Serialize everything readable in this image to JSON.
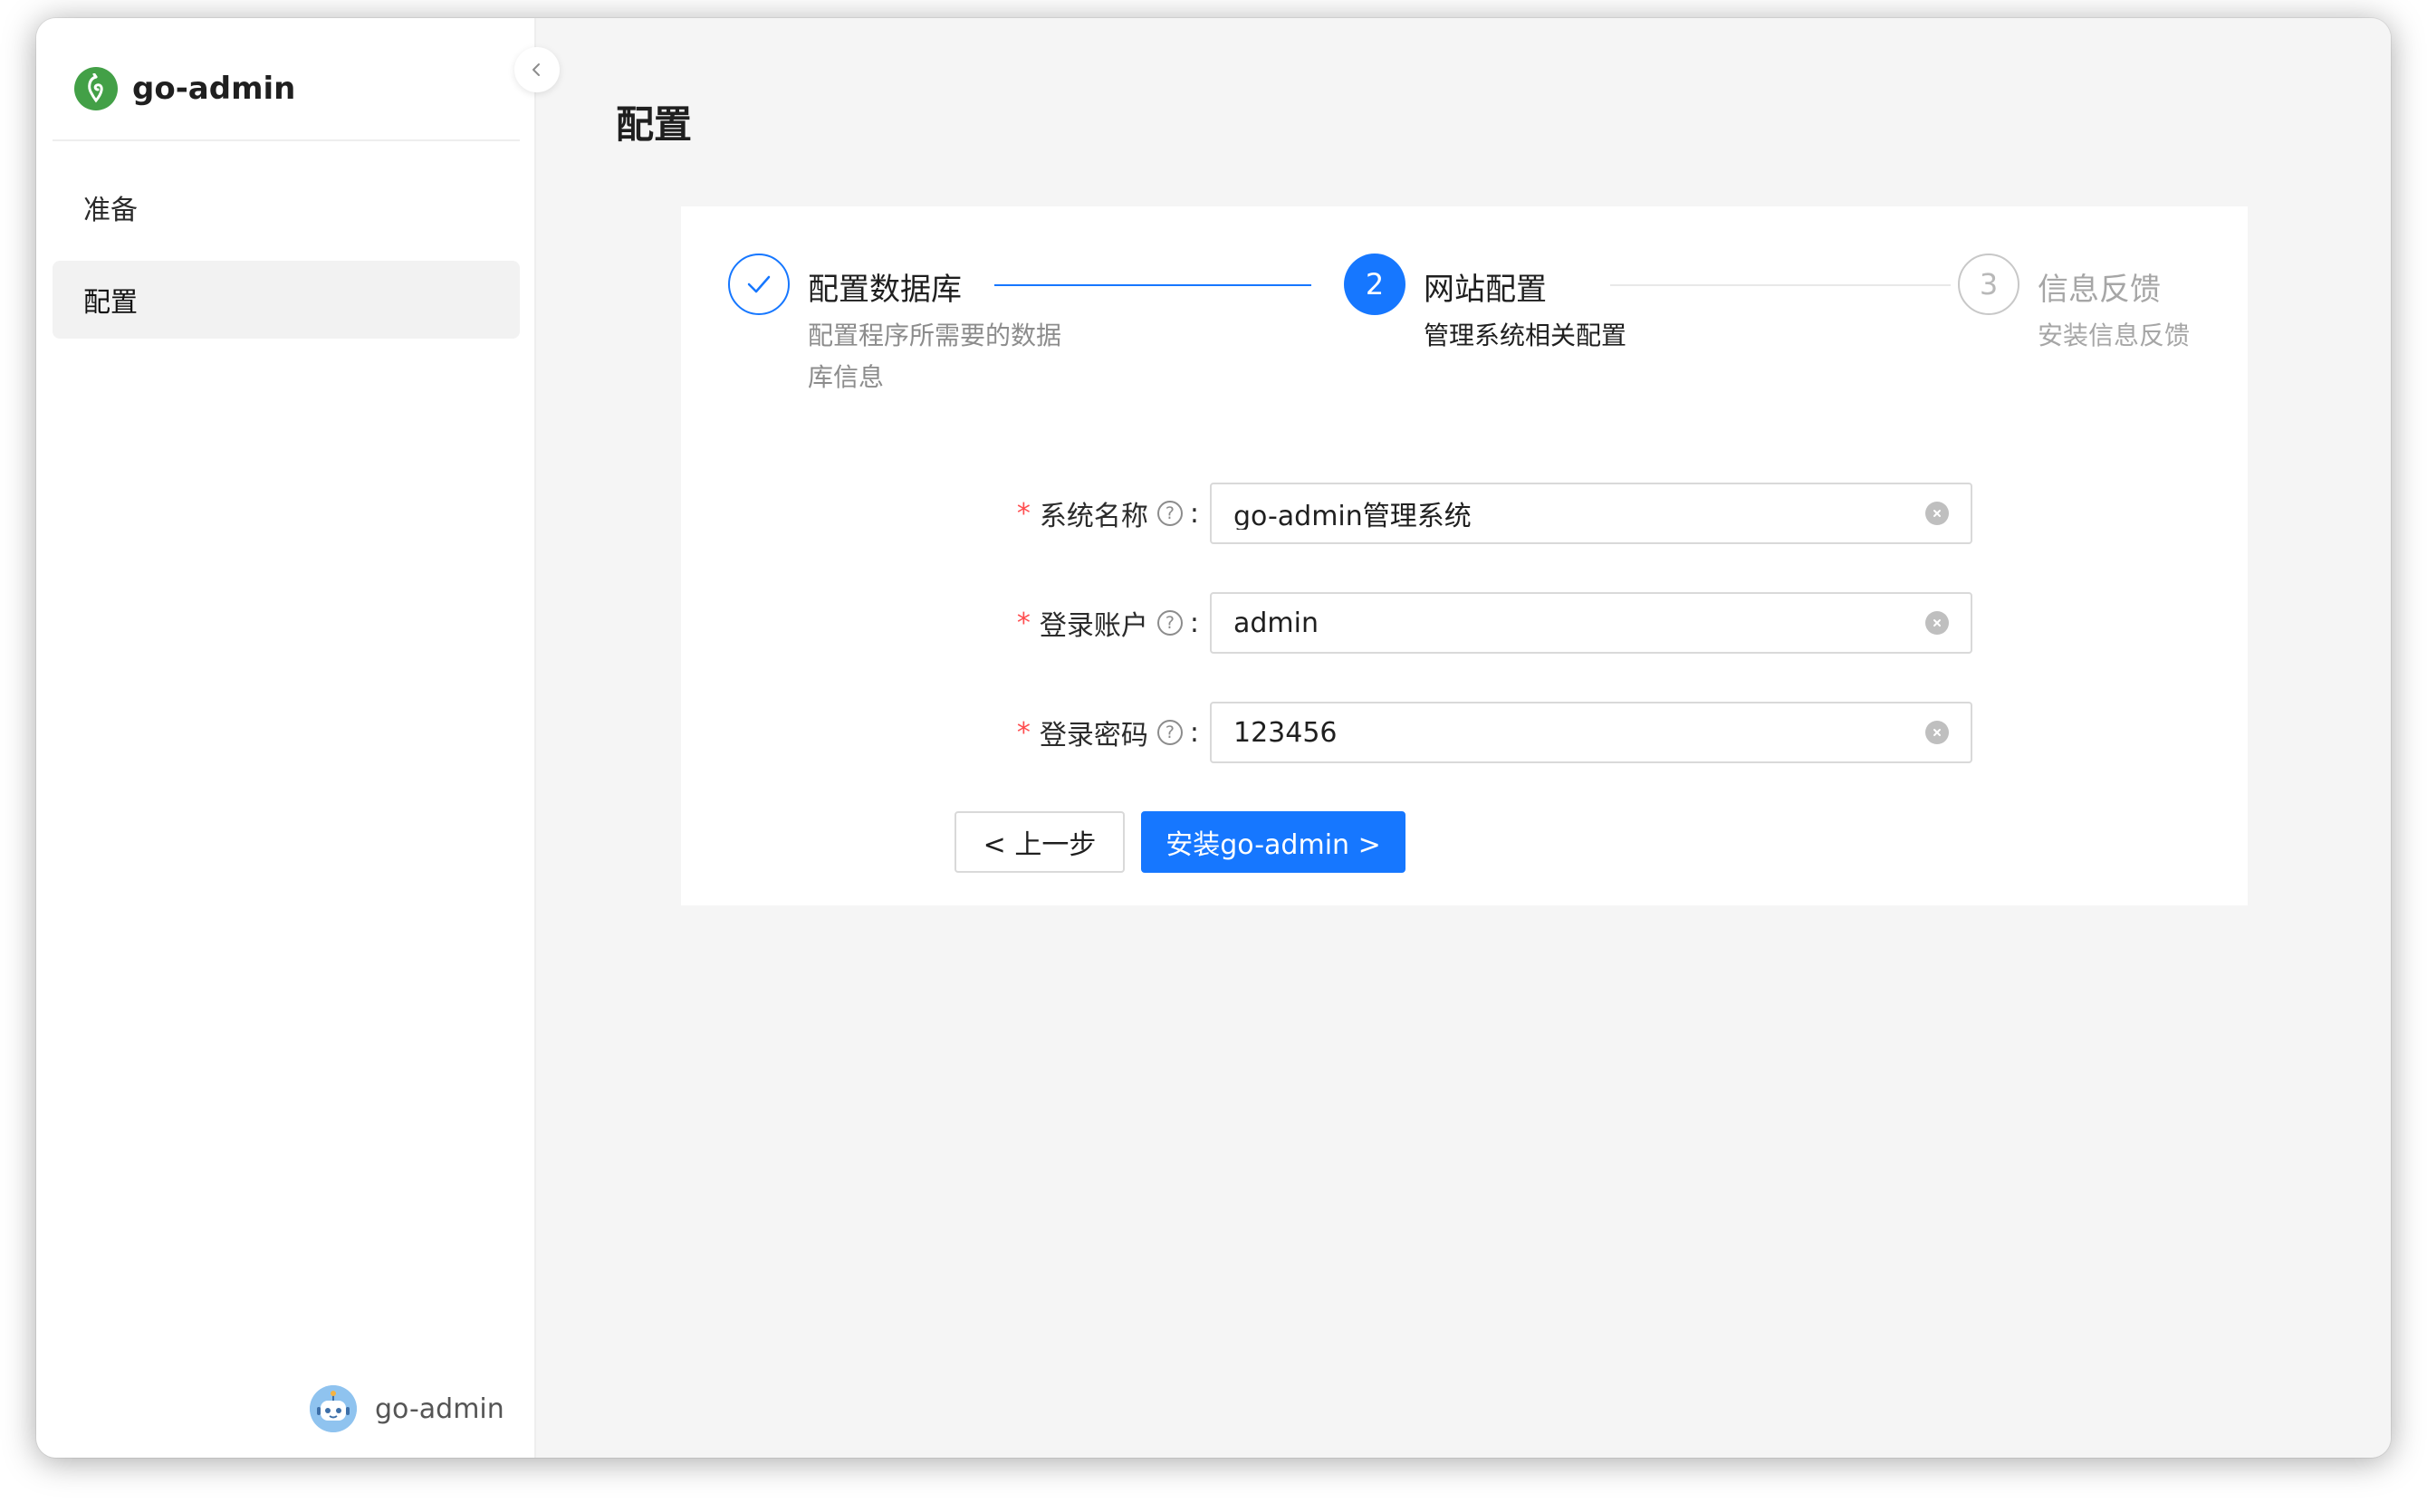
{
  "app": {
    "name": "go-admin",
    "user_name": "go-admin"
  },
  "sidebar": {
    "items": [
      {
        "label": "准备",
        "active": false
      },
      {
        "label": "配置",
        "active": true
      }
    ]
  },
  "main": {
    "title": "配置"
  },
  "steps": [
    {
      "status": "done",
      "number": "1",
      "title": "配置数据库",
      "description_lines": [
        "配置程序所需要的数据",
        "库信息"
      ]
    },
    {
      "status": "current",
      "number": "2",
      "title": "网站配置",
      "description_lines": [
        "管理系统相关配置"
      ]
    },
    {
      "status": "wait",
      "number": "3",
      "title": "信息反馈",
      "description_lines": [
        "安装信息反馈"
      ]
    }
  ],
  "form": {
    "required_mark": "*",
    "help_glyph": "?",
    "colon": ":",
    "fields": [
      {
        "label": "系统名称",
        "value": "go-admin管理系统"
      },
      {
        "label": "登录账户",
        "value": "admin"
      },
      {
        "label": "登录密码",
        "value": "123456"
      }
    ]
  },
  "buttons": {
    "prev_label": "< 上一步",
    "install_label": "安装go-admin >"
  },
  "colors": {
    "primary": "#1677ff",
    "logo_green": "#43a047",
    "required": "#ff4d4f",
    "step_wait": "#b8b8b8"
  },
  "icons": {
    "logo": "go-admin-logo-icon",
    "collapse": "chevron-left-icon",
    "step_done": "check-icon",
    "help": "question-circle-icon",
    "clear": "close-circle-icon",
    "avatar": "robot-avatar-icon"
  }
}
